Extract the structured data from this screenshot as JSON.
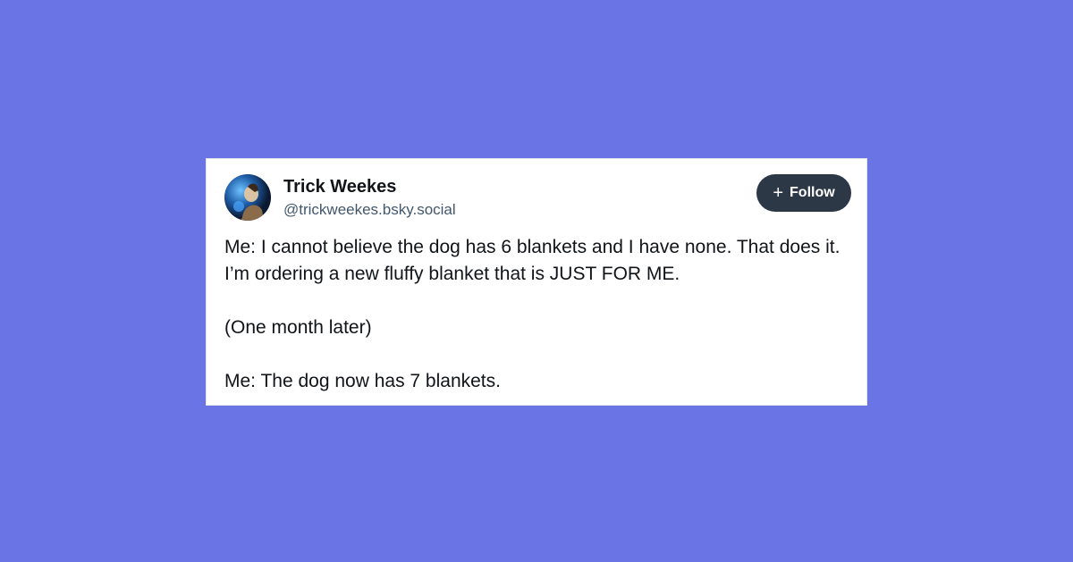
{
  "post": {
    "author": {
      "display_name": "Trick Weekes",
      "handle": "@trickweekes.bsky.social",
      "avatar_icon": "avatar-image"
    },
    "follow_button": {
      "icon": "plus-icon",
      "label": "Follow"
    },
    "paragraphs": [
      "Me: I cannot believe the dog has 6 blankets and I have none. That does it. I’m ordering a new fluffy blanket that is JUST FOR ME.",
      "(One month later)",
      "Me: The dog now has 7 blankets."
    ]
  },
  "colors": {
    "background": "#6b74e4",
    "card": "#ffffff",
    "button": "#2c3846",
    "handle": "#42576c"
  }
}
